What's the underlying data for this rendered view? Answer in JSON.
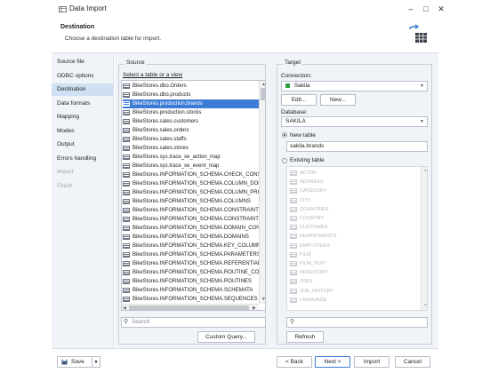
{
  "window": {
    "title": "Data Import"
  },
  "header": {
    "title": "Destination",
    "subtitle": "Choose a destination table for import."
  },
  "sidebar": {
    "items": [
      {
        "label": "Source file",
        "state": "normal"
      },
      {
        "label": "ODBC options",
        "state": "normal"
      },
      {
        "label": "Destination",
        "state": "active"
      },
      {
        "label": "Data formats",
        "state": "normal"
      },
      {
        "label": "Mapping",
        "state": "normal"
      },
      {
        "label": "Modes",
        "state": "normal"
      },
      {
        "label": "Output",
        "state": "normal"
      },
      {
        "label": "Errors handling",
        "state": "normal"
      },
      {
        "label": "Import",
        "state": "disabled"
      },
      {
        "label": "Finish",
        "state": "disabled"
      }
    ]
  },
  "source": {
    "group_label": "Source",
    "select_label": "Select a table or a view",
    "tables": [
      "BikeStores.dbo.Orders",
      "BikeStores.dbo.products",
      "BikeStores.production.brands",
      "BikeStores.production.stocks",
      "BikeStores.sales.customers",
      "BikeStores.sales.orders",
      "BikeStores.sales.staffs",
      "BikeStores.sales.stores",
      "BikeStores.sys.trace_xe_action_map",
      "BikeStores.sys.trace_xe_event_map",
      "BikeStores.INFORMATION_SCHEMA.CHECK_CONSTR",
      "BikeStores.INFORMATION_SCHEMA.COLUMN_DOMA",
      "BikeStores.INFORMATION_SCHEMA.COLUMN_PRIVIL",
      "BikeStores.INFORMATION_SCHEMA.COLUMNS",
      "BikeStores.INFORMATION_SCHEMA.CONSTRAINT_C",
      "BikeStores.INFORMATION_SCHEMA.CONSTRAINT_T",
      "BikeStores.INFORMATION_SCHEMA.DOMAIN_CONST",
      "BikeStores.INFORMATION_SCHEMA.DOMAINS",
      "BikeStores.INFORMATION_SCHEMA.KEY_COLUMN_U",
      "BikeStores.INFORMATION_SCHEMA.PARAMETERS",
      "BikeStores.INFORMATION_SCHEMA.REFERENTIAL_C",
      "BikeStores.INFORMATION_SCHEMA.ROUTINE_COLU",
      "BikeStores.INFORMATION_SCHEMA.ROUTINES",
      "BikeStores.INFORMATION_SCHEMA.SCHEMATA",
      "BikeStores.INFORMATION_SCHEMA.SEQUENCES"
    ],
    "selected_index": 2,
    "search_placeholder": "Search",
    "custom_query_label": "Custom Query..."
  },
  "target": {
    "group_label": "Target",
    "connection_label": "Connection:",
    "connection_value": "Sakila",
    "edit_label": "Edit...",
    "new_label": "New...",
    "database_label": "Database:",
    "database_value": "SAKILA",
    "new_table_label": "New table",
    "new_table_value": "sakila.brands",
    "existing_table_label": "Existing table",
    "existing_tables": [
      "ACTOR",
      "ADDRESS",
      "CATEGORY",
      "CITY",
      "COUNTRIES",
      "COUNTRY",
      "CUSTOMER",
      "DEPARTMENTS",
      "EMPLOYEES",
      "FILM",
      "FILM_TEXT",
      "INVENTORY",
      "JOBS",
      "JOB_HISTORY",
      "LANGUAGE"
    ],
    "refresh_label": "Refresh"
  },
  "footer": {
    "save_label": "Save",
    "back_label": "< Back",
    "next_label": "Next >",
    "import_label": "Import",
    "cancel_label": "Cancel"
  },
  "colors": {
    "accent": "#3d7cd6",
    "selection_bg": "#cfe0f3",
    "panel_bg": "#f0f3f8",
    "connection_status": "#2ea043"
  }
}
